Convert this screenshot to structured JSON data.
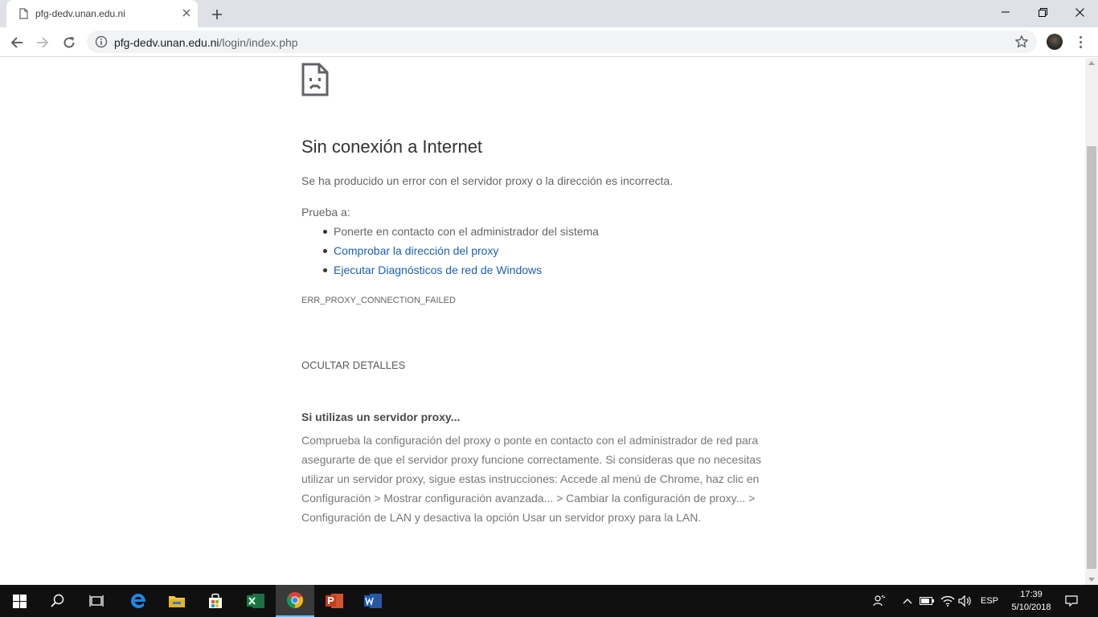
{
  "browser": {
    "tab_title": "pfg-dedv.unan.edu.ni",
    "url_host": "pfg-dedv.unan.edu.ni",
    "url_path": "/login/index.php",
    "icons": [
      "page-icon",
      "close-icon",
      "plus-icon",
      "minimize-icon",
      "restore-icon",
      "close-window-icon",
      "back-arrow-icon",
      "forward-arrow-icon",
      "reload-icon",
      "info-icon",
      "star-icon",
      "avatar",
      "menu-dots-icon"
    ]
  },
  "page": {
    "heading": "Sin conexión a Internet",
    "description": "Se ha producido un error con el servidor proxy o la dirección es incorrecta.",
    "try_label": "Prueba a:",
    "suggestions": [
      "Ponerte en contacto con el administrador del sistema",
      "Comprobar la dirección del proxy",
      "Ejecutar Diagnósticos de red de Windows"
    ],
    "error_code": "ERR_PROXY_CONNECTION_FAILED",
    "details_button": "OCULTAR DETALLES",
    "proxy_title": "Si utilizas un servidor proxy...",
    "proxy_text": "Comprueba la configuración del proxy o ponte en contacto con el administrador de red para asegurarte de que el servidor proxy funcione correctamente. Si consideras que no necesitas utilizar un servidor proxy, sigue estas instrucciones: Accede al menú de Chrome, haz clic en Configuración > Mostrar configuración avanzada... > Cambiar la configuración de proxy... > Configuración de LAN y desactiva la opción Usar un servidor proxy para la LAN.",
    "link_color": "#1a5fb4"
  },
  "taskbar": {
    "language": "ESP",
    "time": "17:39",
    "date": "5/10/2018",
    "apps": [
      "windows-start-icon",
      "search-icon",
      "task-view-icon",
      "edge-icon",
      "file-explorer-icon",
      "store-icon",
      "excel-icon",
      "chrome-icon",
      "powerpoint-icon",
      "word-icon"
    ]
  }
}
